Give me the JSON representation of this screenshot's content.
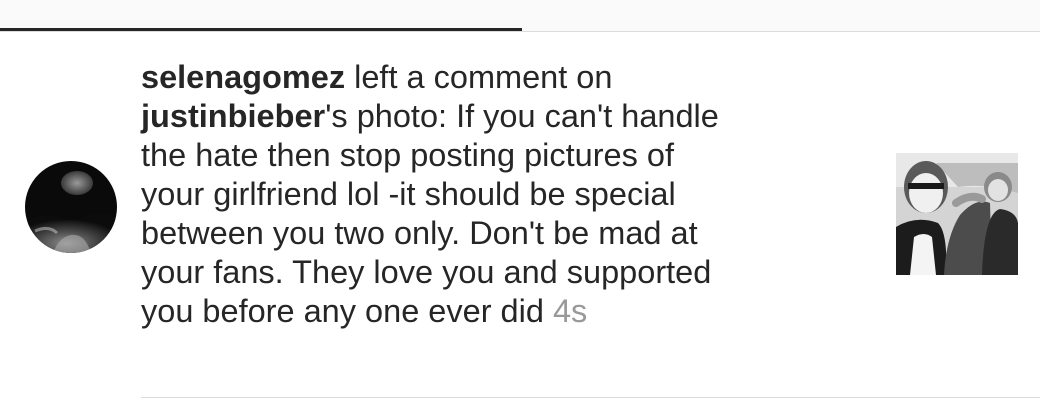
{
  "notification": {
    "actor": "selenagomez",
    "action": " left a comment on",
    "post_owner": "justinbieber",
    "comment": "'s photo: If you can't handle\nthe hate then stop posting pictures of\nyour girlfriend lol -it should be special\nbetween you two only. Don't be mad at\nyour fans. They love you and supported\nyou before any one ever did ",
    "timestamp": "4s"
  },
  "icons": {
    "avatar": "profile-photo",
    "post": "post-thumbnail"
  },
  "colors": {
    "text": "#262626",
    "timestamp": "#999999",
    "divider": "#dbdbdb",
    "active_tab": "#262626"
  }
}
